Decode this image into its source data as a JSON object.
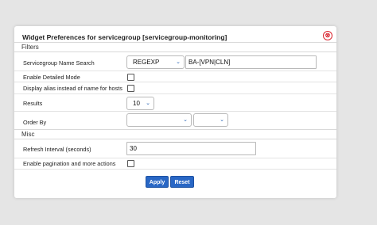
{
  "dialog": {
    "title": "Widget Preferences for servicegroup [servicegroup-monitoring]",
    "close_icon": "⊗"
  },
  "sections": {
    "filters": "Filters",
    "misc": "Misc"
  },
  "fields": {
    "servicegroup_name_search": {
      "label": "Servicegroup Name Search",
      "operator": "REGEXP",
      "value": "BA-[VPN|CLN]"
    },
    "enable_detailed_mode": {
      "label": "Enable Detailed Mode",
      "checked": false
    },
    "display_alias": {
      "label": "Display alias instead of name for hosts",
      "checked": false
    },
    "results": {
      "label": "Results",
      "value": "10"
    },
    "order_by": {
      "label": "Order By",
      "field": "",
      "direction": ""
    },
    "refresh_interval": {
      "label": "Refresh Interval (seconds)",
      "value": "30"
    },
    "enable_pagination": {
      "label": "Enable pagination and more actions",
      "checked": false
    }
  },
  "buttons": {
    "apply": "Apply",
    "reset": "Reset"
  },
  "colors": {
    "primary": "#2967c5",
    "close": "#d9232d",
    "background": "#e5e5e5"
  }
}
